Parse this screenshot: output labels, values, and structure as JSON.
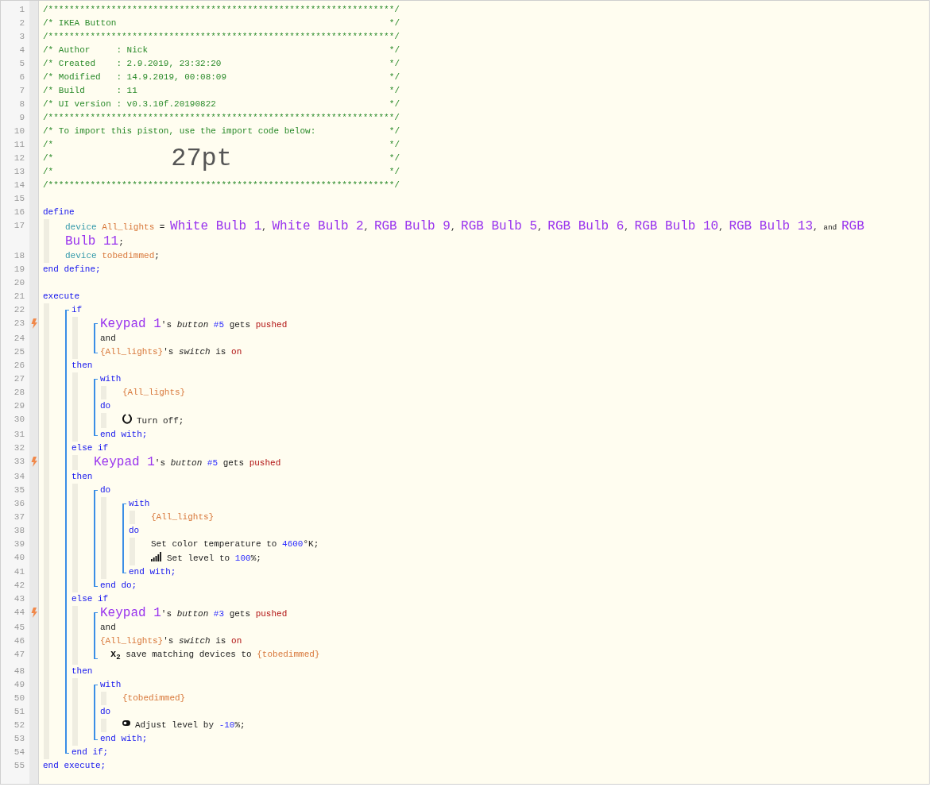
{
  "editor": {
    "lines": [
      {
        "number": "1",
        "kind": "comment",
        "tokens": [
          {
            "kind": "cmt",
            "text": "/******************************************************************/"
          }
        ]
      },
      {
        "number": "2",
        "kind": "comment",
        "tokens": [
          {
            "kind": "cmt",
            "text": "/* IKEA Button"
          },
          {
            "kind": "cmt",
            "text": "*/"
          }
        ]
      },
      {
        "number": "3",
        "kind": "comment",
        "tokens": [
          {
            "kind": "cmt",
            "text": "/******************************************************************/"
          }
        ]
      },
      {
        "number": "4",
        "kind": "comment",
        "tokens": [
          {
            "kind": "cmt",
            "text": "/* Author     : Nick"
          },
          {
            "kind": "cmt",
            "text": "*/"
          }
        ]
      },
      {
        "number": "5",
        "kind": "comment",
        "tokens": [
          {
            "kind": "cmt",
            "text": "/* Created    : 2.9.2019, 23:32:20"
          },
          {
            "kind": "cmt",
            "text": "*/"
          }
        ]
      },
      {
        "number": "6",
        "kind": "comment",
        "tokens": [
          {
            "kind": "cmt",
            "text": "/* Modified   : 14.9.2019, 00:08:09"
          },
          {
            "kind": "cmt",
            "text": "*/"
          }
        ]
      },
      {
        "number": "7",
        "kind": "comment",
        "tokens": [
          {
            "kind": "cmt",
            "text": "/* Build      : 11"
          },
          {
            "kind": "cmt",
            "text": "*/"
          }
        ]
      },
      {
        "number": "8",
        "kind": "comment",
        "tokens": [
          {
            "kind": "cmt",
            "text": "/* UI version : v0.3.10f.20190822"
          },
          {
            "kind": "cmt",
            "text": "*/"
          }
        ]
      },
      {
        "number": "9",
        "kind": "comment",
        "tokens": [
          {
            "kind": "cmt",
            "text": "/******************************************************************/"
          }
        ]
      },
      {
        "number": "10",
        "kind": "comment",
        "tokens": [
          {
            "kind": "cmt",
            "text": "/* To import this piston, use the import code below:"
          },
          {
            "kind": "cmt",
            "text": "*/"
          }
        ]
      },
      {
        "number": "11",
        "kind": "comment",
        "tokens": [
          {
            "kind": "cmt",
            "text": "/*"
          },
          {
            "kind": "cmt",
            "text": "*/"
          }
        ]
      },
      {
        "number": "12",
        "kind": "comment",
        "overlay": "27pt",
        "tokens": [
          {
            "kind": "cmt",
            "text": "/*"
          },
          {
            "kind": "cmt",
            "text": "*/"
          }
        ]
      },
      {
        "number": "13",
        "kind": "comment",
        "tokens": [
          {
            "kind": "cmt",
            "text": "/*"
          },
          {
            "kind": "cmt",
            "text": "*/"
          }
        ]
      },
      {
        "number": "14",
        "kind": "comment",
        "tokens": [
          {
            "kind": "cmt",
            "text": "/******************************************************************/"
          }
        ]
      },
      {
        "number": "15",
        "kind": "blank"
      },
      {
        "number": "16",
        "kind": "code",
        "trigger": false,
        "tokens": [
          {
            "kind": "kw",
            "text": "define"
          }
        ],
        "children": [
          {
            "number": "17",
            "kind": "code",
            "trigger": false,
            "tokens": [
              {
                "kind": "type",
                "text": "device "
              },
              {
                "kind": "var",
                "text": "All_lights"
              },
              {
                "kind": "txt",
                "text": " = "
              },
              {
                "kind": "dev",
                "text": "White Bulb 1"
              },
              {
                "kind": "txt",
                "text": ", "
              },
              {
                "kind": "dev",
                "text": "White Bulb 2"
              },
              {
                "kind": "txt",
                "text": ", "
              },
              {
                "kind": "dev",
                "text": "RGB Bulb 9"
              },
              {
                "kind": "txt",
                "text": ", "
              },
              {
                "kind": "dev",
                "text": "RGB Bulb 5"
              },
              {
                "kind": "txt",
                "text": ", "
              },
              {
                "kind": "dev",
                "text": "RGB Bulb 6"
              },
              {
                "kind": "txt",
                "text": ", "
              },
              {
                "kind": "dev",
                "text": "RGB Bulb 10"
              },
              {
                "kind": "txt",
                "text": ", "
              },
              {
                "kind": "dev",
                "text": "RGB Bulb 13"
              },
              {
                "kind": "txt",
                "text": ", "
              },
              {
                "kind": "small",
                "text": "and "
              },
              {
                "kind": "dev",
                "text": "RGB Bulb 11"
              },
              {
                "kind": "txt",
                "text": ";"
              }
            ]
          },
          {
            "number": "18",
            "kind": "code",
            "trigger": false,
            "tokens": [
              {
                "kind": "type",
                "text": "device "
              },
              {
                "kind": "var",
                "text": "tobedimmed"
              },
              {
                "kind": "txt",
                "text": ";"
              }
            ]
          }
        ]
      },
      {
        "number": "19",
        "kind": "code",
        "trigger": false,
        "tokens": [
          {
            "kind": "kw",
            "text": "end define;"
          }
        ]
      },
      {
        "number": "20",
        "kind": "blank"
      },
      {
        "number": "21",
        "kind": "code",
        "trigger": false,
        "tokens": [
          {
            "kind": "kw",
            "text": "execute"
          }
        ],
        "children": [
          {
            "kind": "group",
            "items": [
              {
                "number": "22",
                "kind": "code",
                "trigger": false,
                "tokens": [
                  {
                    "kind": "kw",
                    "text": "if"
                  }
                ],
                "children": [
                  {
                    "kind": "group",
                    "items": [
                      {
                        "number": "23",
                        "kind": "code",
                        "trigger": true,
                        "tokens": [
                          {
                            "kind": "dev",
                            "text": "Keypad 1"
                          },
                          {
                            "kind": "txt",
                            "text": "'s "
                          },
                          {
                            "kind": "ital",
                            "text": "button "
                          },
                          {
                            "kind": "num",
                            "text": "#5"
                          },
                          {
                            "kind": "txt",
                            "text": " gets "
                          },
                          {
                            "kind": "val",
                            "text": "pushed"
                          }
                        ]
                      },
                      {
                        "number": "24",
                        "kind": "code",
                        "trigger": false,
                        "tokens": [
                          {
                            "kind": "txt",
                            "text": "and"
                          }
                        ]
                      },
                      {
                        "number": "25",
                        "kind": "code",
                        "trigger": false,
                        "tokens": [
                          {
                            "kind": "var",
                            "text": "{All_lights}"
                          },
                          {
                            "kind": "txt",
                            "text": "'s "
                          },
                          {
                            "kind": "ital",
                            "text": "switch"
                          },
                          {
                            "kind": "txt",
                            "text": " is "
                          },
                          {
                            "kind": "val",
                            "text": "on"
                          }
                        ]
                      }
                    ]
                  }
                ]
              },
              {
                "number": "26",
                "kind": "code",
                "trigger": false,
                "tokens": [
                  {
                    "kind": "kw",
                    "text": "then"
                  }
                ],
                "children": [
                  {
                    "kind": "group",
                    "items": [
                      {
                        "number": "27",
                        "kind": "code",
                        "trigger": false,
                        "tokens": [
                          {
                            "kind": "kw",
                            "text": "with"
                          }
                        ],
                        "children": [
                          {
                            "number": "28",
                            "kind": "code",
                            "trigger": false,
                            "tokens": [
                              {
                                "kind": "var",
                                "text": "{All_lights}"
                              }
                            ]
                          }
                        ]
                      },
                      {
                        "number": "29",
                        "kind": "code",
                        "trigger": false,
                        "tokens": [
                          {
                            "kind": "kw",
                            "text": "do"
                          }
                        ],
                        "children": [
                          {
                            "number": "30",
                            "kind": "code",
                            "trigger": false,
                            "tokens": [
                              {
                                "kind": "power"
                              },
                              {
                                "kind": "txt",
                                "text": "Turn off;"
                              }
                            ]
                          }
                        ]
                      },
                      {
                        "number": "31",
                        "kind": "code",
                        "trigger": false,
                        "tokens": [
                          {
                            "kind": "kw",
                            "text": "end with;"
                          }
                        ]
                      }
                    ]
                  }
                ]
              },
              {
                "number": "32",
                "kind": "code",
                "trigger": false,
                "tokens": [
                  {
                    "kind": "kw",
                    "text": "else if"
                  }
                ],
                "children": [
                  {
                    "number": "33",
                    "kind": "code",
                    "trigger": true,
                    "tokens": [
                      {
                        "kind": "dev",
                        "text": "Keypad 1"
                      },
                      {
                        "kind": "txt",
                        "text": "'s "
                      },
                      {
                        "kind": "ital",
                        "text": "button "
                      },
                      {
                        "kind": "num",
                        "text": "#5"
                      },
                      {
                        "kind": "txt",
                        "text": " gets "
                      },
                      {
                        "kind": "val",
                        "text": "pushed"
                      }
                    ]
                  }
                ]
              },
              {
                "number": "34",
                "kind": "code",
                "trigger": false,
                "tokens": [
                  {
                    "kind": "kw",
                    "text": "then"
                  }
                ],
                "children": [
                  {
                    "kind": "group",
                    "items": [
                      {
                        "number": "35",
                        "kind": "code",
                        "trigger": false,
                        "tokens": [
                          {
                            "kind": "kw",
                            "text": "do"
                          }
                        ],
                        "children": [
                          {
                            "kind": "group",
                            "items": [
                              {
                                "number": "36",
                                "kind": "code",
                                "trigger": false,
                                "tokens": [
                                  {
                                    "kind": "kw",
                                    "text": "with"
                                  }
                                ],
                                "children": [
                                  {
                                    "number": "37",
                                    "kind": "code",
                                    "trigger": false,
                                    "tokens": [
                                      {
                                        "kind": "var",
                                        "text": "{All_lights}"
                                      }
                                    ]
                                  }
                                ]
                              },
                              {
                                "number": "38",
                                "kind": "code",
                                "trigger": false,
                                "tokens": [
                                  {
                                    "kind": "kw",
                                    "text": "do"
                                  }
                                ],
                                "children": [
                                  {
                                    "number": "39",
                                    "kind": "code",
                                    "trigger": false,
                                    "tokens": [
                                      {
                                        "kind": "txt",
                                        "text": "Set color temperature to "
                                      },
                                      {
                                        "kind": "num",
                                        "text": "4600"
                                      },
                                      {
                                        "kind": "txt",
                                        "text": "°K;"
                                      }
                                    ]
                                  },
                                  {
                                    "number": "40",
                                    "kind": "code",
                                    "trigger": false,
                                    "tokens": [
                                      {
                                        "kind": "signal"
                                      },
                                      {
                                        "kind": "txt",
                                        "text": "Set level to "
                                      },
                                      {
                                        "kind": "num",
                                        "text": "100"
                                      },
                                      {
                                        "kind": "txt",
                                        "text": "%;"
                                      }
                                    ]
                                  }
                                ]
                              },
                              {
                                "number": "41",
                                "kind": "code",
                                "trigger": false,
                                "tokens": [
                                  {
                                    "kind": "kw",
                                    "text": "end with;"
                                  }
                                ]
                              }
                            ]
                          }
                        ]
                      },
                      {
                        "number": "42",
                        "kind": "code",
                        "trigger": false,
                        "tokens": [
                          {
                            "kind": "kw",
                            "text": "end do;"
                          }
                        ]
                      }
                    ]
                  }
                ]
              },
              {
                "number": "43",
                "kind": "code",
                "trigger": false,
                "tokens": [
                  {
                    "kind": "kw",
                    "text": "else if"
                  }
                ],
                "children": [
                  {
                    "kind": "group",
                    "items": [
                      {
                        "number": "44",
                        "kind": "code",
                        "trigger": true,
                        "tokens": [
                          {
                            "kind": "dev",
                            "text": "Keypad 1"
                          },
                          {
                            "kind": "txt",
                            "text": "'s "
                          },
                          {
                            "kind": "ital",
                            "text": "button "
                          },
                          {
                            "kind": "num",
                            "text": "#3"
                          },
                          {
                            "kind": "txt",
                            "text": " gets "
                          },
                          {
                            "kind": "val",
                            "text": "pushed"
                          }
                        ]
                      },
                      {
                        "number": "45",
                        "kind": "code",
                        "trigger": false,
                        "tokens": [
                          {
                            "kind": "txt",
                            "text": "and"
                          }
                        ]
                      },
                      {
                        "number": "46",
                        "kind": "code",
                        "trigger": false,
                        "tokens": [
                          {
                            "kind": "var",
                            "text": "{All_lights}"
                          },
                          {
                            "kind": "txt",
                            "text": "'s "
                          },
                          {
                            "kind": "ital",
                            "text": "switch"
                          },
                          {
                            "kind": "txt",
                            "text": " is "
                          },
                          {
                            "kind": "val",
                            "text": "on"
                          }
                        ]
                      },
                      {
                        "number": "47",
                        "kind": "code",
                        "trigger": false,
                        "tokens": [
                          {
                            "kind": "mark",
                            "text": "x$_{2}$"
                          },
                          {
                            "kind": "txt",
                            "text": " save matching devices to "
                          },
                          {
                            "kind": "var",
                            "text": "{tobedimmed}"
                          }
                        ]
                      }
                    ]
                  }
                ]
              },
              {
                "number": "48",
                "kind": "code",
                "trigger": false,
                "tokens": [
                  {
                    "kind": "kw",
                    "text": "then"
                  }
                ],
                "children": [
                  {
                    "kind": "group",
                    "items": [
                      {
                        "number": "49",
                        "kind": "code",
                        "trigger": false,
                        "tokens": [
                          {
                            "kind": "kw",
                            "text": "with"
                          }
                        ],
                        "children": [
                          {
                            "number": "50",
                            "kind": "code",
                            "trigger": false,
                            "tokens": [
                              {
                                "kind": "var",
                                "text": "{tobedimmed}"
                              }
                            ]
                          }
                        ]
                      },
                      {
                        "number": "51",
                        "kind": "code",
                        "trigger": false,
                        "tokens": [
                          {
                            "kind": "kw",
                            "text": "do"
                          }
                        ],
                        "children": [
                          {
                            "number": "52",
                            "kind": "code",
                            "trigger": false,
                            "tokens": [
                              {
                                "kind": "toggle"
                              },
                              {
                                "kind": "txt",
                                "text": "Adjust level by "
                              },
                              {
                                "kind": "num",
                                "text": "-10"
                              },
                              {
                                "kind": "txt",
                                "text": "%;"
                              }
                            ]
                          }
                        ]
                      },
                      {
                        "number": "53",
                        "kind": "code",
                        "trigger": false,
                        "tokens": [
                          {
                            "kind": "kw",
                            "text": "end with;"
                          }
                        ]
                      }
                    ]
                  }
                ]
              },
              {
                "number": "54",
                "kind": "code",
                "trigger": false,
                "tokens": [
                  {
                    "kind": "kw",
                    "text": "end if;"
                  }
                ]
              }
            ]
          }
        ]
      },
      {
        "number": "55",
        "kind": "code",
        "trigger": false,
        "tokens": [
          {
            "kind": "kw",
            "text": "end execute;"
          }
        ]
      }
    ]
  }
}
